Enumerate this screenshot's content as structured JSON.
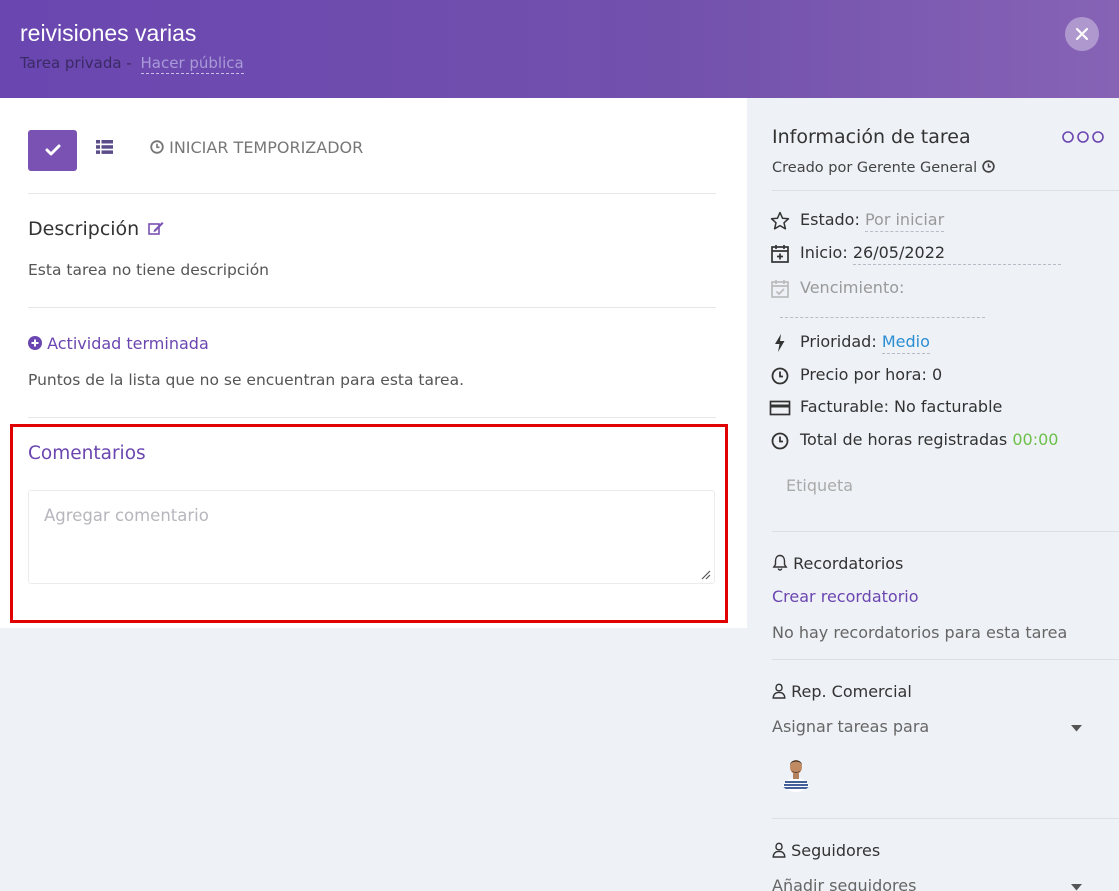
{
  "header": {
    "title": "reivisiones varias",
    "subtitle_prefix": "Tarea privada -",
    "subtitle_link": "Hacer pública"
  },
  "toolbar": {
    "timer_label": "INICIAR TEMPORIZADOR"
  },
  "description": {
    "title": "Descripción",
    "empty_text": "Esta tarea no tiene descripción"
  },
  "activity": {
    "link_label": "Actividad terminada",
    "empty_text": "Puntos de la lista que no se encuentran para esta tarea."
  },
  "comments": {
    "title": "Comentarios",
    "placeholder": "Agregar comentario",
    "value": ""
  },
  "info": {
    "title": "Información de tarea",
    "creator": "Creado por Gerente General",
    "status_label": "Estado:",
    "status_value": "Por iniciar",
    "start_label": "Inicio:",
    "start_value": "26/05/2022",
    "due_label": "Vencimiento:",
    "priority_label": "Prioridad:",
    "priority_value": "Medio",
    "hourly_label": "Precio por hora: 0",
    "billable_label": "Facturable: No facturable",
    "total_hours_label": "Total de horas registradas",
    "total_hours_value": "00:00",
    "tag_placeholder": "Etiqueta"
  },
  "reminders": {
    "title": "Recordatorios",
    "create_link": "Crear recordatorio",
    "empty_text": "No hay recordatorios para esta tarea"
  },
  "sales_rep": {
    "title": "Rep. Comercial",
    "assign_placeholder": "Asignar tareas para"
  },
  "followers": {
    "title": "Seguidores",
    "add_placeholder": "Añadir seguidores"
  },
  "colors": {
    "header_purple": "#6a46b0",
    "accent_purple": "#7952b3",
    "link_blue": "#2a8ed3",
    "time_green": "#6cc04a",
    "highlight_red": "#e00000"
  },
  "icons": [
    "close-icon",
    "check-icon",
    "list-icon",
    "clock-icon",
    "edit-icon",
    "plus-circle-icon",
    "more-icon",
    "star-icon",
    "calendar-plus-icon",
    "calendar-check-icon",
    "bolt-icon",
    "credit-card-icon",
    "bell-icon",
    "user-icon",
    "chevron-down-icon"
  ]
}
